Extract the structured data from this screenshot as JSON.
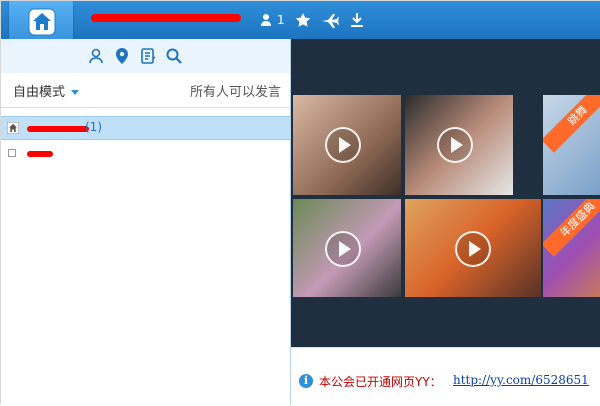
{
  "header": {
    "user_count": "1"
  },
  "toolbar": {
    "tools": [
      "users-icon",
      "location-icon",
      "notes-icon",
      "search-icon"
    ]
  },
  "mode": {
    "label": "自由模式",
    "speak_status": "所有人可以发言"
  },
  "tree": {
    "channel_count": "(1)"
  },
  "stage": {
    "thumbs": [
      {
        "ribbon": ""
      },
      {
        "ribbon": ""
      },
      {
        "ribbon": "跳舞"
      },
      {
        "ribbon": ""
      },
      {
        "ribbon": ""
      },
      {
        "ribbon": "年度盛典"
      }
    ]
  },
  "notice": {
    "text": "本公会已开通网页YY：",
    "link": "http://yy.com/6528651"
  },
  "colors": {
    "topbar": "#1d74c0",
    "accent": "#2f8fd8",
    "stage_bg": "#1f2f3f",
    "notice_text": "#c40000",
    "ribbon": "#ff6a2b"
  }
}
